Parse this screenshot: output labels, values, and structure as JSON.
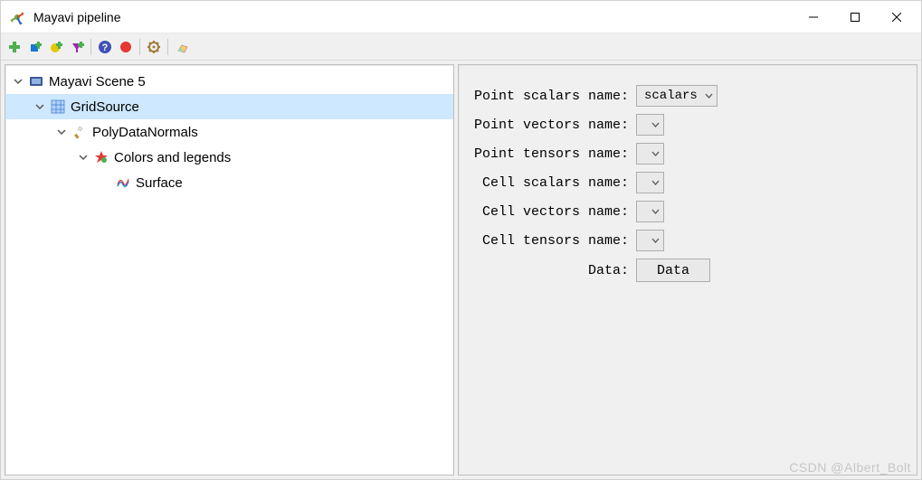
{
  "window": {
    "title": "Mayavi pipeline"
  },
  "toolbar": {
    "icons": [
      "add",
      "add-scene",
      "add-module",
      "add-filter",
      "help",
      "record",
      "settings",
      "eraser"
    ]
  },
  "tree": {
    "nodes": [
      {
        "depth": 0,
        "expander": true,
        "icon": "scene",
        "label": "Mayavi Scene 5",
        "selected": false
      },
      {
        "depth": 1,
        "expander": true,
        "icon": "grid-source",
        "label": "GridSource",
        "selected": true
      },
      {
        "depth": 2,
        "expander": true,
        "icon": "poly-normals",
        "label": "PolyDataNormals",
        "selected": false
      },
      {
        "depth": 3,
        "expander": true,
        "icon": "colors-legends",
        "label": "Colors and legends",
        "selected": false
      },
      {
        "depth": 4,
        "expander": false,
        "icon": "surface",
        "label": "Surface",
        "selected": false
      }
    ]
  },
  "props": {
    "rows": [
      {
        "label": "Point scalars name:",
        "type": "combo",
        "value": "scalars"
      },
      {
        "label": "Point vectors name:",
        "type": "combo",
        "value": ""
      },
      {
        "label": "Point tensors name:",
        "type": "combo",
        "value": ""
      },
      {
        "label": "Cell scalars name:",
        "type": "combo",
        "value": ""
      },
      {
        "label": "Cell vectors name:",
        "type": "combo",
        "value": ""
      },
      {
        "label": "Cell tensors name:",
        "type": "combo",
        "value": ""
      },
      {
        "label": "Data:",
        "type": "button",
        "value": "Data"
      }
    ]
  },
  "watermark": "CSDN @Albert_Bolt"
}
